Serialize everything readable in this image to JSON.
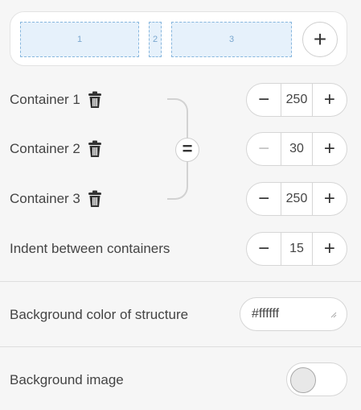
{
  "preview": {
    "containers": [
      {
        "label": "1"
      },
      {
        "label": "2"
      },
      {
        "label": "3"
      }
    ],
    "add_label": "+"
  },
  "containers": [
    {
      "label": "Container 1",
      "value": "250",
      "minus": "−",
      "plus": "+"
    },
    {
      "label": "Container 2",
      "value": "30",
      "minus": "−",
      "plus": "+"
    },
    {
      "label": "Container 3",
      "value": "250",
      "minus": "−",
      "plus": "+"
    }
  ],
  "equalize_label": "=",
  "indent": {
    "label": "Indent between containers",
    "value": "15",
    "minus": "−",
    "plus": "+"
  },
  "background_color": {
    "label": "Background color of structure",
    "value": "#ffffff"
  },
  "background_image": {
    "label": "Background image",
    "enabled": false
  },
  "icons": {
    "trash": "trash-icon",
    "plus": "plus-icon",
    "minus": "minus-icon",
    "equalize": "equals-icon",
    "resize": "resize-grip-icon"
  }
}
